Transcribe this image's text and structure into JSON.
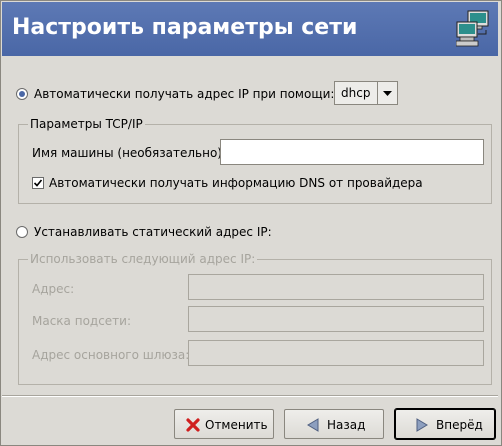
{
  "header": {
    "title": "Настроить параметры сети"
  },
  "auto": {
    "radio_label": "Автоматически получать адрес IP при помощи:",
    "method_value": "dhcp",
    "tcp_group_title": "Параметры TCP/IP",
    "hostname_label": "Имя машины (необязательно):",
    "hostname_value": "",
    "dns_checkbox_label": "Автоматически получать информацию DNS от провайдера"
  },
  "static": {
    "radio_label": "Устанавливать статический адрес IP:",
    "group_title": "Использовать следующий адрес IP:",
    "address_label": "Адрес:",
    "mask_label": "Маска подсети:",
    "gateway_label": "Адрес основного шлюза:",
    "address_value": "",
    "mask_value": "",
    "gateway_value": ""
  },
  "buttons": {
    "cancel": "Отменить",
    "back": "Назад",
    "next": "Вперёд"
  },
  "colors": {
    "header_bg": "#4a67a6",
    "window_bg": "#dcdad5",
    "disabled_text": "#a6a49d"
  },
  "icons": {
    "network": "network-computers-icon",
    "cancel": "red-x-icon",
    "back": "left-arrow-icon",
    "next": "right-arrow-icon"
  }
}
